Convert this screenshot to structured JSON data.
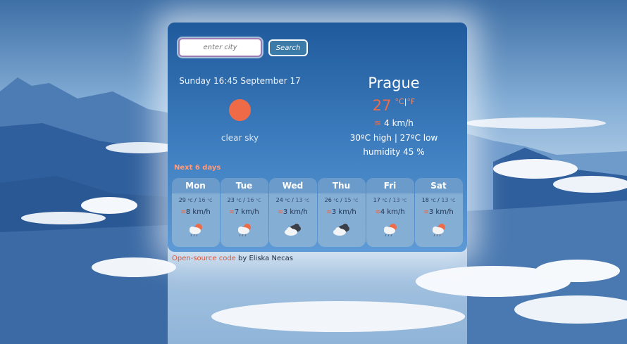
{
  "search": {
    "placeholder": "enter city",
    "button_label": "Search"
  },
  "current": {
    "datetime": "Sunday 16:45 September 17",
    "description": "clear sky",
    "city": "Prague",
    "temperature": "27",
    "unit_celsius": "°C",
    "unit_separator": "|",
    "unit_fahrenheit": "°F",
    "wind": "4 km/h",
    "high_low": "30ºC high | 27ºC low",
    "humidity": "humidity 45 %"
  },
  "forecast": {
    "label": "Next 6 days",
    "days": [
      {
        "name": "Mon",
        "high": "29",
        "low": "16",
        "wind": "8 km/h",
        "icon": "rain-sun-icon"
      },
      {
        "name": "Tue",
        "high": "23",
        "low": "16",
        "wind": "7 km/h",
        "icon": "rain-sun-icon"
      },
      {
        "name": "Wed",
        "high": "24",
        "low": "13",
        "wind": "3 km/h",
        "icon": "dark-cloud-icon"
      },
      {
        "name": "Thu",
        "high": "26",
        "low": "15",
        "wind": "3 km/h",
        "icon": "dark-cloud-icon"
      },
      {
        "name": "Fri",
        "high": "17",
        "low": "13",
        "wind": "4 km/h",
        "icon": "rain-sun-icon"
      },
      {
        "name": "Sat",
        "high": "18",
        "low": "13",
        "wind": "3 km/h",
        "icon": "rain-sun-icon"
      }
    ],
    "unit": "°C"
  },
  "footer": {
    "link_text": "Open-source code",
    "byline": " by Eliska Necas"
  },
  "colors": {
    "accent": "#ef6a47",
    "card_top": "#1f5a9c",
    "card_bottom": "#5d9ad6"
  }
}
